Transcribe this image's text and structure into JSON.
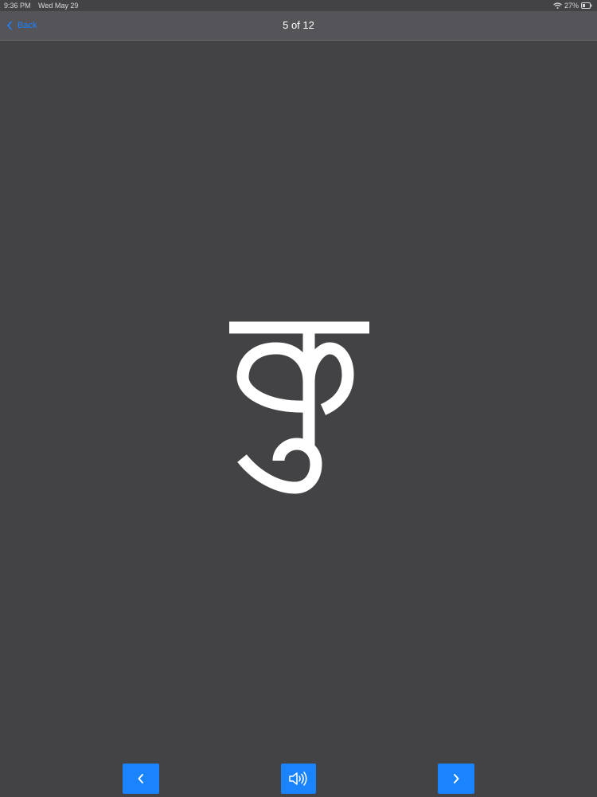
{
  "status_bar": {
    "time": "9:36 PM",
    "date": "Wed May 29",
    "battery": "27%"
  },
  "nav": {
    "back_label": "Back",
    "title": "5 of 12"
  },
  "flashcard": {
    "character": "कु"
  },
  "controls": {
    "previous_icon": "chevron-left-icon",
    "sound_icon": "speaker-icon",
    "next_icon": "chevron-right-icon"
  },
  "colors": {
    "background": "#434245",
    "navbar": "#555458",
    "accent": "#1a84ff",
    "glyph": "#ffffff"
  }
}
